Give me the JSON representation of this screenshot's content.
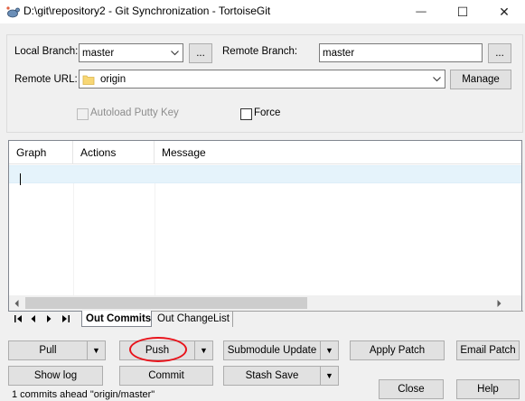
{
  "window": {
    "title": "D:\\git\\repository2 - Git Synchronization - TortoiseGit",
    "minimize_glyph": "—",
    "maximize_glyph": "☐",
    "close_glyph": "✕"
  },
  "branches": {
    "local_label": "Local Branch:",
    "local_value": "master",
    "local_browse": "...",
    "remote_label": "Remote Branch:",
    "remote_value": "master",
    "remote_browse": "...",
    "url_label": "Remote URL:",
    "url_value": "origin",
    "manage_label": "Manage"
  },
  "options": {
    "autoload_label": "Autoload Putty Key",
    "autoload_checked": false,
    "autoload_enabled": false,
    "force_label": "Force",
    "force_checked": false
  },
  "list": {
    "columns": [
      "Graph",
      "Actions",
      "Message"
    ],
    "rows": []
  },
  "tabs": {
    "items": [
      "Out Commits",
      "Out ChangeList"
    ],
    "active": "Out Commits",
    "nav": [
      "⏮",
      "◀",
      "▶",
      "⏭"
    ]
  },
  "buttons": {
    "pull": "Pull",
    "push": "Push",
    "submodule_update": "Submodule Update",
    "apply_patch": "Apply Patch",
    "email_patch": "Email Patch",
    "show_log": "Show log",
    "commit": "Commit",
    "stash_save": "Stash Save",
    "close": "Close",
    "help": "Help",
    "dropdown_glyph": "▼"
  },
  "status": {
    "text": "1 commits ahead \"origin/master\""
  },
  "colors": {
    "highlight_ring": "#e8131b",
    "folder_icon": "#f8d775",
    "selected_row": "#e5f3fb"
  }
}
